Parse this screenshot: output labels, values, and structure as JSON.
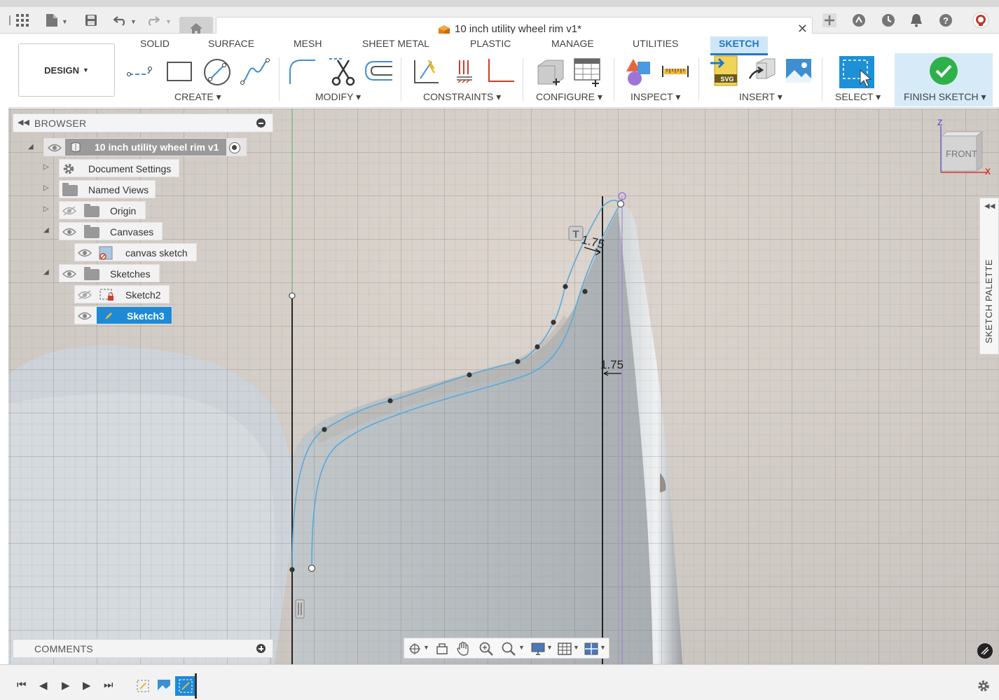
{
  "window": {
    "document_title": "10 inch utility wheel rim v1*"
  },
  "workspace_button": "DESIGN",
  "ribbon": {
    "tabs": [
      "SOLID",
      "SURFACE",
      "MESH",
      "SHEET METAL",
      "PLASTIC",
      "MANAGE",
      "UTILITIES",
      "SKETCH"
    ],
    "active_tab": "SKETCH",
    "groups": {
      "create": "CREATE",
      "modify": "MODIFY",
      "constraints": "CONSTRAINTS",
      "configure": "CONFIGURE",
      "inspect": "INSPECT",
      "insert": "INSERT",
      "select": "SELECT",
      "finish": "FINISH SKETCH"
    }
  },
  "browser": {
    "title": "BROWSER",
    "root": "10 inch utility wheel rim v1",
    "items": {
      "document_settings": "Document Settings",
      "named_views": "Named Views",
      "origin": "Origin",
      "canvases": "Canvases",
      "canvas_sketch": "canvas sketch",
      "sketches": "Sketches",
      "sketch2": "Sketch2",
      "sketch3": "Sketch3"
    }
  },
  "viewcube": {
    "face": "FRONT",
    "axis_z": "Z",
    "axis_x": "X"
  },
  "sketch_palette": "SKETCH PALETTE",
  "dimensions": {
    "offset_a": "1.75",
    "offset_b": "1.75"
  },
  "comments": "COMMENTS",
  "colors": {
    "accent": "#1e7ac3",
    "sketch_curve": "#5aa9dc",
    "finish_green": "#2eb14a"
  }
}
